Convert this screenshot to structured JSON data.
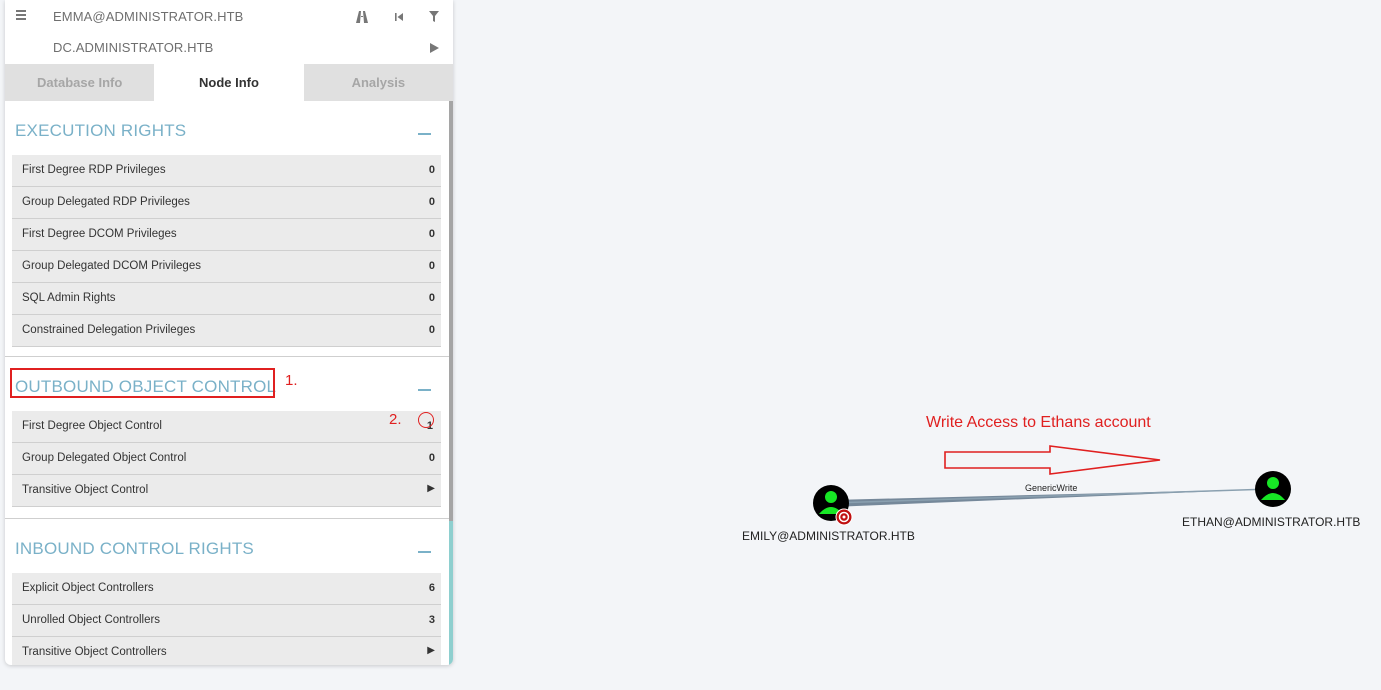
{
  "search": {
    "start_node": "EMMA@ADMINISTRATOR.HTB",
    "end_node": "DC.ADMINISTRATOR.HTB"
  },
  "tabs": [
    {
      "label": "Database Info",
      "active": false
    },
    {
      "label": "Node Info",
      "active": true
    },
    {
      "label": "Analysis",
      "active": false
    }
  ],
  "sections": {
    "execution": {
      "title": "EXECUTION RIGHTS",
      "rows": [
        {
          "label": "First Degree RDP Privileges",
          "value": "0"
        },
        {
          "label": "Group Delegated RDP Privileges",
          "value": "0"
        },
        {
          "label": "First Degree DCOM Privileges",
          "value": "0"
        },
        {
          "label": "Group Delegated DCOM Privileges",
          "value": "0"
        },
        {
          "label": "SQL Admin Rights",
          "value": "0"
        },
        {
          "label": "Constrained Delegation Privileges",
          "value": "0"
        }
      ]
    },
    "outbound": {
      "title": "OUTBOUND OBJECT CONTROL",
      "rows": [
        {
          "label": "First Degree Object Control",
          "value": "1"
        },
        {
          "label": "Group Delegated Object Control",
          "value": "0"
        },
        {
          "label": "Transitive Object Control",
          "value": ""
        }
      ]
    },
    "inbound": {
      "title": "INBOUND CONTROL RIGHTS",
      "rows": [
        {
          "label": "Explicit Object Controllers",
          "value": "6"
        },
        {
          "label": "Unrolled Object Controllers",
          "value": "3"
        },
        {
          "label": "Transitive Object Controllers",
          "value": ""
        }
      ]
    }
  },
  "annotations": {
    "step1": "1.",
    "step2": "2.",
    "graph_note": "Write Access to Ethans account"
  },
  "graph": {
    "source_node": "EMILY@ADMINISTRATOR.HTB",
    "target_node": "ETHAN@ADMINISTRATOR.HTB",
    "edge_label": "GenericWrite"
  },
  "colors": {
    "accent": "#7ab1c8",
    "annotation": "#e02020",
    "node_user": "#17e625",
    "edge": "#8295a3"
  }
}
